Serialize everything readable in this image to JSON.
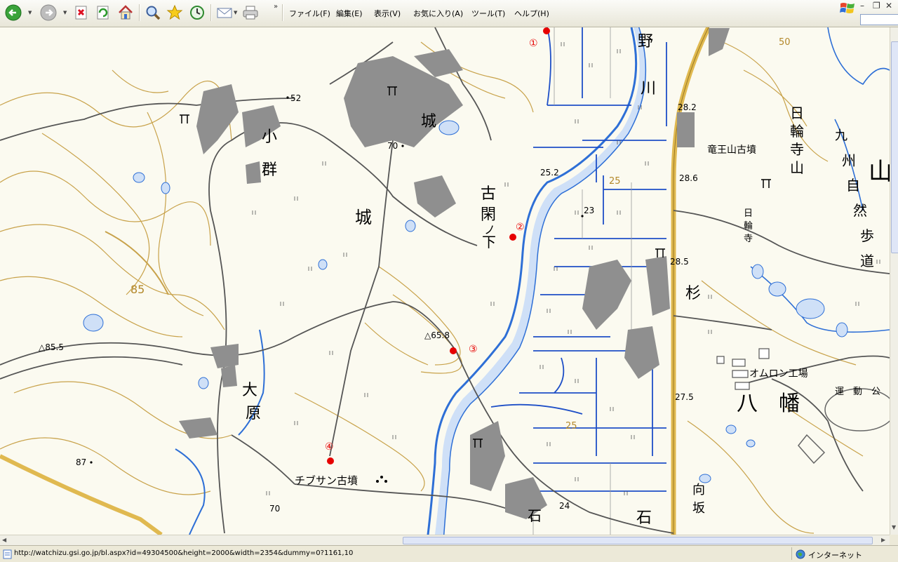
{
  "menu": [
    "ファイル(F)",
    "編集(E)",
    "表示(V)",
    "お気に入り(A)",
    "ツール(T)",
    "ヘルプ(H)"
  ],
  "toolbar_icons": [
    "back-icon",
    "forward-icon",
    "stop-icon",
    "refresh-icon",
    "home-icon",
    "search-icon",
    "favorites-icon",
    "history-icon",
    "mail-icon",
    "print-icon"
  ],
  "map": {
    "places": {
      "ogumi1": "小",
      "ogumi2": "群",
      "shiro_top": "城",
      "shiro_mid": "城",
      "furukan1": "古",
      "furukan2": "閑",
      "furukan3": "ノ",
      "furukan4": "下",
      "no": "野",
      "kawa": "川",
      "nichirin1": "日",
      "nichirin2": "輪",
      "nichirin3": "寺",
      "nichirin4": "山",
      "kyushu1": "九",
      "kyushu2": "州",
      "kyushu3": "自",
      "kyushu4": "然",
      "kyushu5": "歩",
      "kyushu6": "道",
      "yama": "山",
      "ryuozan": "竜王山古墳",
      "nichirinji1": "日",
      "nichirinji2": "輪",
      "nichirinji3": "寺",
      "sugi": "杉",
      "omron": "オムロン工場",
      "undo": "運　動　公",
      "yahata1": "八",
      "yahata2": "幡",
      "ohara1": "大",
      "ohara2": "原",
      "chifusan": "チブサン古墳",
      "ishi1": "石",
      "ishi2": "石",
      "mukosaka1": "向",
      "mukosaka2": "坂"
    },
    "elevations": {
      "e52": "52",
      "e70a": "70",
      "e252": "25.2",
      "e282": "28.2",
      "e286": "28.6",
      "e23": "23",
      "e285": "28.5",
      "e85": "85",
      "e658": "△65.8",
      "e855": "△85.5",
      "e275": "27.5",
      "e87": "87",
      "e70b": "70",
      "e24": "24",
      "e25a": "25",
      "e25b": "25",
      "e50": "50"
    },
    "markers": [
      "①",
      "②",
      "③",
      "④"
    ]
  },
  "status": {
    "url": "http://watchizu.gsi.go.jp/bl.aspx?id=49304500&height=2000&width=2354&dummy=0?1161,10",
    "zone": "インターネット"
  },
  "colors": {
    "water": "#2e6fd6",
    "contour": "#c8a24a",
    "road": "#555555",
    "highway": "#e0b950",
    "marker": "#e60000",
    "building": "#8f8f8f"
  }
}
